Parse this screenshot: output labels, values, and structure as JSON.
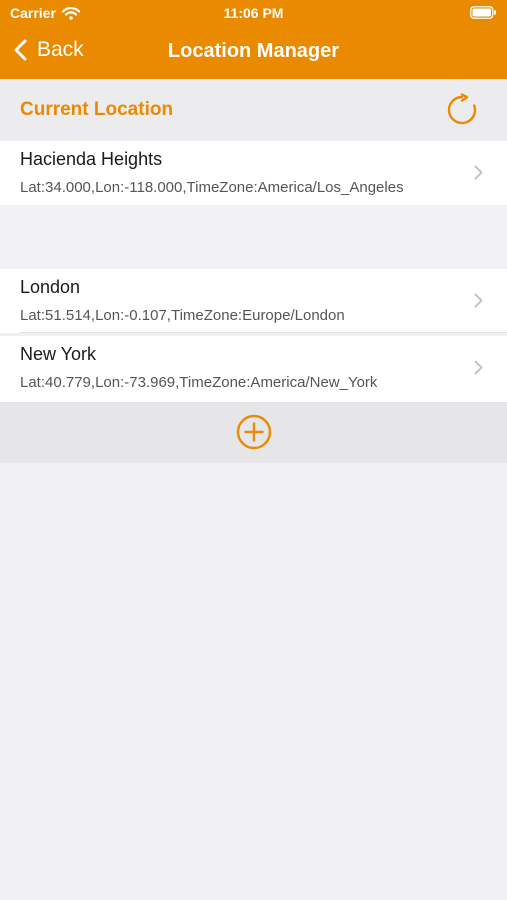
{
  "status_bar": {
    "carrier": "Carrier",
    "time": "11:06 PM"
  },
  "nav": {
    "back_label": "Back",
    "title": "Location Manager"
  },
  "current_section": {
    "title": "Current Location",
    "location": {
      "name": "Hacienda Heights",
      "details": "Lat:34.000,Lon:-118.000,TimeZone:America/Los_Angeles"
    }
  },
  "saved_locations": [
    {
      "name": "London",
      "details": "Lat:51.514,Lon:-0.107,TimeZone:Europe/London"
    },
    {
      "name": "New York",
      "details": "Lat:40.779,Lon:-73.969,TimeZone:America/New_York"
    }
  ],
  "colors": {
    "accent": "#ea8a00",
    "background": "#f0f0f2"
  },
  "icons": {
    "back": "chevron-left-icon",
    "refresh": "refresh-icon",
    "row_disclosure": "chevron-right-icon",
    "add": "plus-circle-icon"
  }
}
